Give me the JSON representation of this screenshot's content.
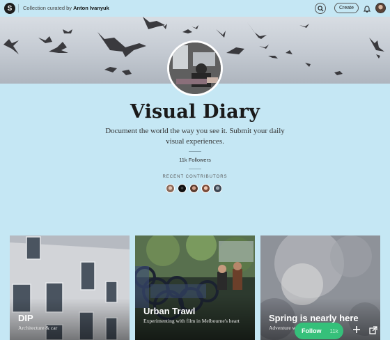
{
  "topbar": {
    "logo_letter": "S",
    "curated_prefix": "Collection curated by",
    "curator_name": "Anton Ivanyuk",
    "create_label": "Create"
  },
  "collection": {
    "title": "Visual Diary",
    "description": "Document the world the way you see it. Submit your daily visual experiences.",
    "followers": "11k Followers",
    "recent_contributors_label": "RECENT CONTRIBUTORS"
  },
  "cards": [
    {
      "title": "DIP",
      "subtitle": "Architecture & car"
    },
    {
      "title": "Urban Trawl",
      "subtitle": "Experimenting with film in Melbourne's heart"
    },
    {
      "title": "Spring is nearly here",
      "subtitle": "Adventure w"
    }
  ],
  "actions": {
    "follow_label": "Follow",
    "follow_count": "11k"
  },
  "colors": {
    "page_background": "#c5e7f4",
    "follow_green": "#35c07a"
  }
}
